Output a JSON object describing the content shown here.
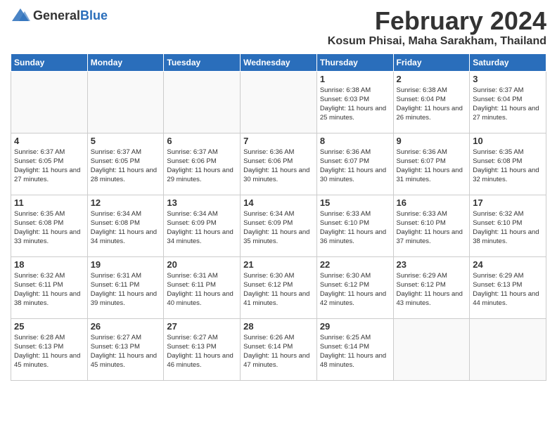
{
  "header": {
    "logo_general": "General",
    "logo_blue": "Blue",
    "month_title": "February 2024",
    "location": "Kosum Phisai, Maha Sarakham, Thailand"
  },
  "days_of_week": [
    "Sunday",
    "Monday",
    "Tuesday",
    "Wednesday",
    "Thursday",
    "Friday",
    "Saturday"
  ],
  "weeks": [
    [
      {
        "day": "",
        "info": ""
      },
      {
        "day": "",
        "info": ""
      },
      {
        "day": "",
        "info": ""
      },
      {
        "day": "",
        "info": ""
      },
      {
        "day": "1",
        "info": "Sunrise: 6:38 AM\nSunset: 6:03 PM\nDaylight: 11 hours\nand 25 minutes."
      },
      {
        "day": "2",
        "info": "Sunrise: 6:38 AM\nSunset: 6:04 PM\nDaylight: 11 hours\nand 26 minutes."
      },
      {
        "day": "3",
        "info": "Sunrise: 6:37 AM\nSunset: 6:04 PM\nDaylight: 11 hours\nand 27 minutes."
      }
    ],
    [
      {
        "day": "4",
        "info": "Sunrise: 6:37 AM\nSunset: 6:05 PM\nDaylight: 11 hours\nand 27 minutes."
      },
      {
        "day": "5",
        "info": "Sunrise: 6:37 AM\nSunset: 6:05 PM\nDaylight: 11 hours\nand 28 minutes."
      },
      {
        "day": "6",
        "info": "Sunrise: 6:37 AM\nSunset: 6:06 PM\nDaylight: 11 hours\nand 29 minutes."
      },
      {
        "day": "7",
        "info": "Sunrise: 6:36 AM\nSunset: 6:06 PM\nDaylight: 11 hours\nand 30 minutes."
      },
      {
        "day": "8",
        "info": "Sunrise: 6:36 AM\nSunset: 6:07 PM\nDaylight: 11 hours\nand 30 minutes."
      },
      {
        "day": "9",
        "info": "Sunrise: 6:36 AM\nSunset: 6:07 PM\nDaylight: 11 hours\nand 31 minutes."
      },
      {
        "day": "10",
        "info": "Sunrise: 6:35 AM\nSunset: 6:08 PM\nDaylight: 11 hours\nand 32 minutes."
      }
    ],
    [
      {
        "day": "11",
        "info": "Sunrise: 6:35 AM\nSunset: 6:08 PM\nDaylight: 11 hours\nand 33 minutes."
      },
      {
        "day": "12",
        "info": "Sunrise: 6:34 AM\nSunset: 6:08 PM\nDaylight: 11 hours\nand 34 minutes."
      },
      {
        "day": "13",
        "info": "Sunrise: 6:34 AM\nSunset: 6:09 PM\nDaylight: 11 hours\nand 34 minutes."
      },
      {
        "day": "14",
        "info": "Sunrise: 6:34 AM\nSunset: 6:09 PM\nDaylight: 11 hours\nand 35 minutes."
      },
      {
        "day": "15",
        "info": "Sunrise: 6:33 AM\nSunset: 6:10 PM\nDaylight: 11 hours\nand 36 minutes."
      },
      {
        "day": "16",
        "info": "Sunrise: 6:33 AM\nSunset: 6:10 PM\nDaylight: 11 hours\nand 37 minutes."
      },
      {
        "day": "17",
        "info": "Sunrise: 6:32 AM\nSunset: 6:10 PM\nDaylight: 11 hours\nand 38 minutes."
      }
    ],
    [
      {
        "day": "18",
        "info": "Sunrise: 6:32 AM\nSunset: 6:11 PM\nDaylight: 11 hours\nand 38 minutes."
      },
      {
        "day": "19",
        "info": "Sunrise: 6:31 AM\nSunset: 6:11 PM\nDaylight: 11 hours\nand 39 minutes."
      },
      {
        "day": "20",
        "info": "Sunrise: 6:31 AM\nSunset: 6:11 PM\nDaylight: 11 hours\nand 40 minutes."
      },
      {
        "day": "21",
        "info": "Sunrise: 6:30 AM\nSunset: 6:12 PM\nDaylight: 11 hours\nand 41 minutes."
      },
      {
        "day": "22",
        "info": "Sunrise: 6:30 AM\nSunset: 6:12 PM\nDaylight: 11 hours\nand 42 minutes."
      },
      {
        "day": "23",
        "info": "Sunrise: 6:29 AM\nSunset: 6:12 PM\nDaylight: 11 hours\nand 43 minutes."
      },
      {
        "day": "24",
        "info": "Sunrise: 6:29 AM\nSunset: 6:13 PM\nDaylight: 11 hours\nand 44 minutes."
      }
    ],
    [
      {
        "day": "25",
        "info": "Sunrise: 6:28 AM\nSunset: 6:13 PM\nDaylight: 11 hours\nand 45 minutes."
      },
      {
        "day": "26",
        "info": "Sunrise: 6:27 AM\nSunset: 6:13 PM\nDaylight: 11 hours\nand 45 minutes."
      },
      {
        "day": "27",
        "info": "Sunrise: 6:27 AM\nSunset: 6:13 PM\nDaylight: 11 hours\nand 46 minutes."
      },
      {
        "day": "28",
        "info": "Sunrise: 6:26 AM\nSunset: 6:14 PM\nDaylight: 11 hours\nand 47 minutes."
      },
      {
        "day": "29",
        "info": "Sunrise: 6:25 AM\nSunset: 6:14 PM\nDaylight: 11 hours\nand 48 minutes."
      },
      {
        "day": "",
        "info": ""
      },
      {
        "day": "",
        "info": ""
      }
    ]
  ]
}
